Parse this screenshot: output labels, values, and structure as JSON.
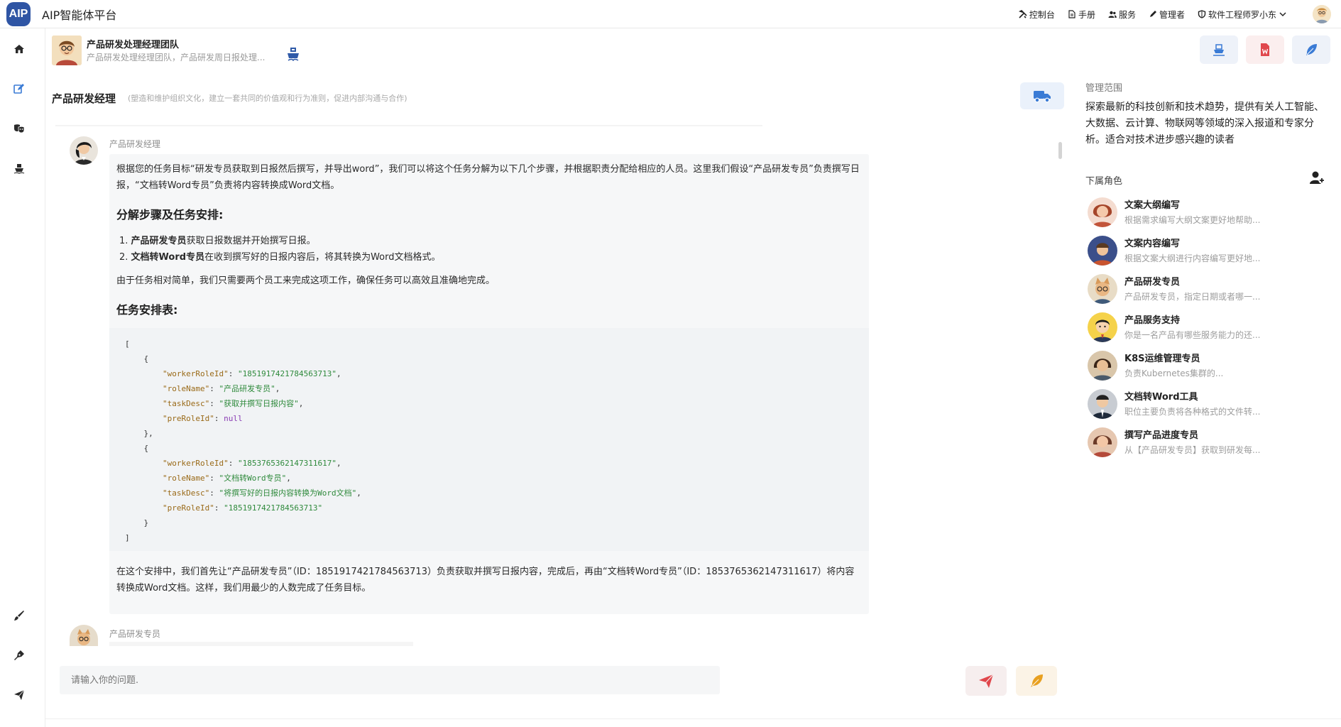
{
  "app": {
    "logo_text": "AIP",
    "title": "AIP智能体平台"
  },
  "topnav": {
    "items": [
      {
        "label": "控制台",
        "icon": "tools-icon"
      },
      {
        "label": "手册",
        "icon": "document-icon"
      },
      {
        "label": "服务",
        "icon": "users-icon"
      },
      {
        "label": "管理者",
        "icon": "pen-icon"
      },
      {
        "label": "软件工程师罗小东",
        "icon": "shield-icon"
      }
    ]
  },
  "sidebar": {
    "items": [
      "home-icon",
      "edit-icon",
      "masks-icon",
      "ship-icon",
      "brush-icon",
      "pen-nib-icon",
      "send-icon"
    ]
  },
  "agent": {
    "name": "产品研发处理经理团队",
    "desc": "产品研发处理经理团队，产品研发周日报处理..."
  },
  "section": {
    "title": "产品研发经理",
    "subtitle": "(塑造和维护组织文化，建立一套共同的价值观和行为准则，促进内部沟通与合作)"
  },
  "chat": {
    "message1": {
      "sender": "产品研发经理",
      "intro": "根据您的任务目标“研发专员获取到日报然后撰写，并导出word”，我们可以将这个任务分解为以下几个步骤，并根据职责分配给相应的人员。这里我们假设“产品研发专员”负责撰写日报，“文档转Word专员”负责将内容转换成Word文档。",
      "heading1": "分解步骤及任务安排:",
      "step1_prefix": "1. ",
      "step1_bold": "产品研发专员",
      "step1_text": "获取日报数据并开始撰写日报。",
      "step2_prefix": "2. ",
      "step2_bold": "文档转Word专员",
      "step2_text": "在收到撰写好的日报内容后，将其转换为Word文档格式。",
      "summary": "由于任务相对简单，我们只需要两个员工来完成这项工作，确保任务可以高效且准确地完成。",
      "heading2": "任务安排表:",
      "code": {
        "open": "[",
        "close": "]",
        "obj_open": "{",
        "obj_close_comma": "},",
        "obj_close": "}",
        "k_worker": "\"workerRoleId\"",
        "k_role": "\"roleName\"",
        "k_task": "\"taskDesc\"",
        "k_pre": "\"preRoleId\"",
        "t1_worker": "\"1851917421784563713\"",
        "t1_role": "\"产品研发专员\"",
        "t1_task": "\"获取并撰写日报内容\"",
        "t1_pre": "null",
        "t2_worker": "\"1853765362147311617\"",
        "t2_role": "\"文档转Word专员\"",
        "t2_task": "\"将撰写好的日报内容转换为Word文档\"",
        "t2_pre": "\"1851917421784563713\""
      },
      "conclusion": "在这个安排中，我们首先让“产品研发专员”（ID：1851917421784563713）负责获取并撰写日报内容，完成后，再由“文档转Word专员”（ID：1853765362147311617）将内容转换成Word文档。这样，我们用最少的人数完成了任务目标。"
    },
    "message2": {
      "sender": "产品研发专员"
    }
  },
  "input": {
    "placeholder": "请输入你的问题."
  },
  "right_panel": {
    "scope_label": "管理范围",
    "scope_text": "探索最新的科技创新和技术趋势，提供有关人工智能、大数据、云计算、物联网等领域的深入报道和专家分析。适合对技术进步感兴趣的读者",
    "roles_label": "下属角色",
    "roles": [
      {
        "name": "文案大纲编写",
        "desc": "根据需求编写大纲文案更好地帮助..."
      },
      {
        "name": "文案内容编写",
        "desc": "根据文案大纲进行内容编写更好地..."
      },
      {
        "name": "产品研发专员",
        "desc": "产品研发专员，指定日期或者哪一..."
      },
      {
        "name": "产品服务支持",
        "desc": "你是一名产品有哪些服务能力的还..."
      },
      {
        "name": "K8S运维管理专员",
        "desc": "负责Kubernetes集群的..."
      },
      {
        "name": "文档转Word工具",
        "desc": "职位主要负责将各种格式的文件转..."
      },
      {
        "name": "撰写产品进度专员",
        "desc": "从【产品研发专员】获取到研发每..."
      }
    ]
  },
  "colors": {
    "accent": "#2f55a4",
    "icon_blue": "#3a7bd5",
    "send_red": "#e0474c",
    "brush_orange": "#e8a020"
  }
}
